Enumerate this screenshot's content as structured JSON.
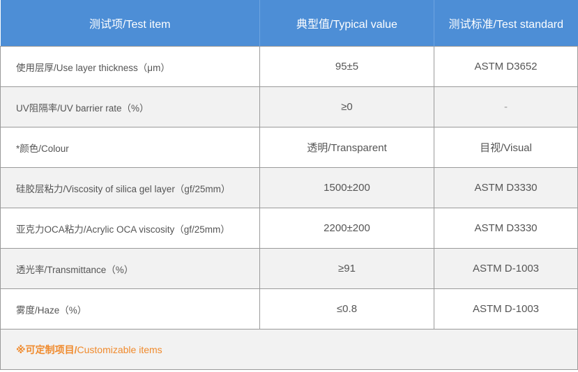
{
  "header": {
    "col1": "测试项/Test item",
    "col2": "典型值/Typical value",
    "col3": "测试标准/Test standard"
  },
  "rows": [
    {
      "item": "使用层厚/Use layer thickness（μm）",
      "value": "95±5",
      "standard": "ASTM D3652"
    },
    {
      "item": "UV阻隔率/UV barrier rate（%）",
      "value": "≥0",
      "standard": "-"
    },
    {
      "item": "*颜色/Colour",
      "value": "透明/Transparent",
      "standard": "目视/Visual"
    },
    {
      "item": "硅胶层粘力/Viscosity of silica gel layer（gf/25mm）",
      "value": "1500±200",
      "standard": "ASTM D3330"
    },
    {
      "item": "亚克力OCA粘力/Acrylic OCA viscosity（gf/25mm）",
      "value": "2200±200",
      "standard": "ASTM D3330"
    },
    {
      "item": "透光率/Transmittance（%）",
      "value": "≥91",
      "standard": "ASTM D-1003"
    },
    {
      "item": "雾度/Haze（%）",
      "value": "≤0.8",
      "standard": "ASTM D-1003"
    }
  ],
  "footer": {
    "note_cn": "※可定制项目/",
    "note_en": "Customizable items"
  },
  "colors": {
    "header_bg": "#4d8ed6",
    "footer_text": "#f08a2c",
    "row_alt_bg": "#f2f2f2"
  }
}
